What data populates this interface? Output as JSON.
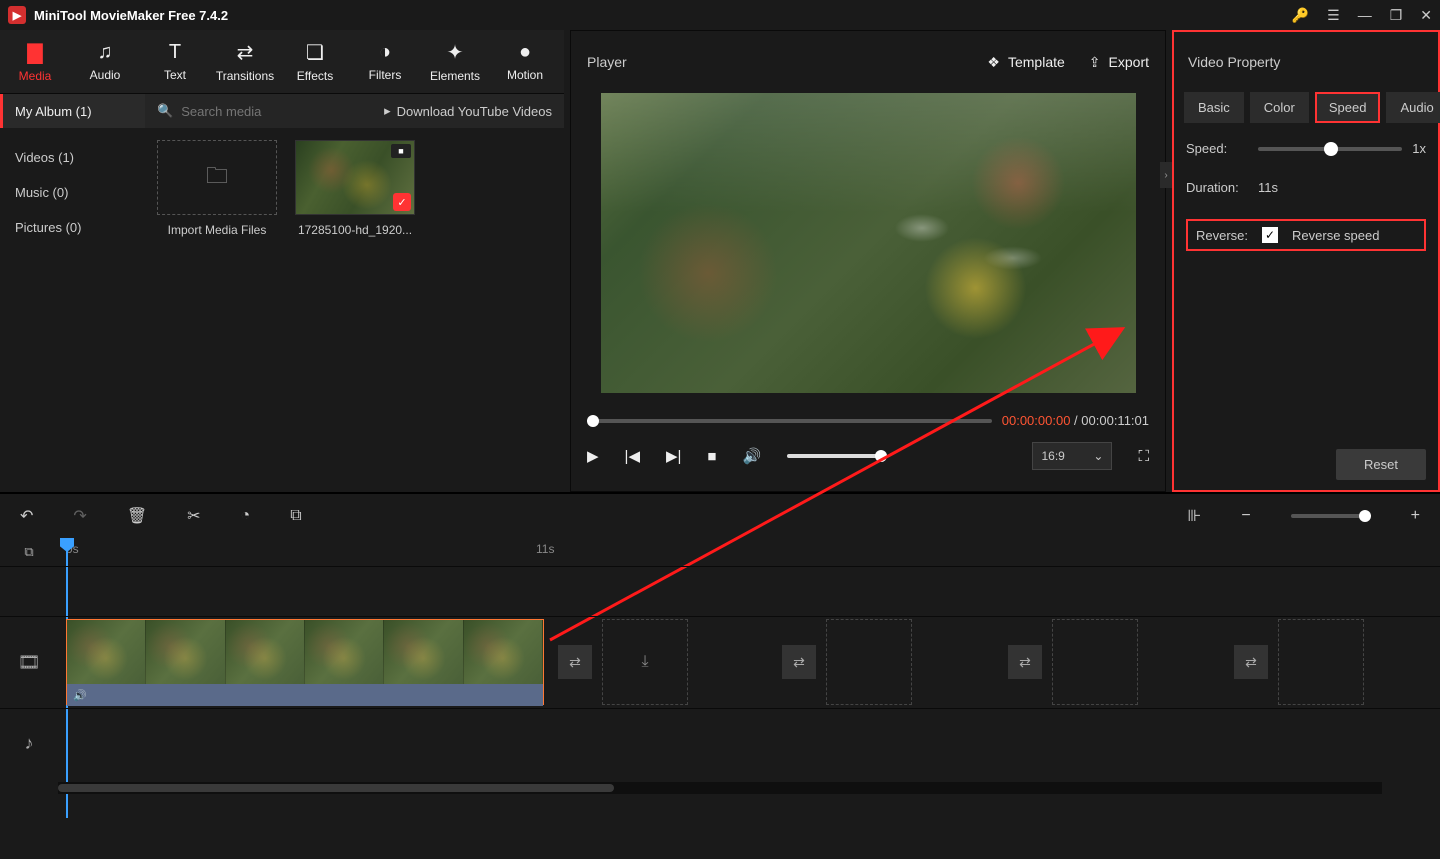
{
  "titlebar": {
    "app_title": "MiniTool MovieMaker Free 7.4.2"
  },
  "toolbar": {
    "items": [
      {
        "label": "Media"
      },
      {
        "label": "Audio"
      },
      {
        "label": "Text"
      },
      {
        "label": "Transitions"
      },
      {
        "label": "Effects"
      },
      {
        "label": "Filters"
      },
      {
        "label": "Elements"
      },
      {
        "label": "Motion"
      }
    ]
  },
  "media": {
    "album_tab": "My Album (1)",
    "search_placeholder": "Search media",
    "youtube_link": "Download YouTube Videos",
    "sidebar": {
      "videos": "Videos (1)",
      "music": "Music (0)",
      "pictures": "Pictures (0)"
    },
    "import_label": "Import Media Files",
    "clip_name": "17285100-hd_1920..."
  },
  "player": {
    "title": "Player",
    "template_btn": "Template",
    "export_btn": "Export",
    "time_current": "00:00:00:00",
    "time_sep": " / ",
    "time_total": "00:00:11:01",
    "ratio": "16:9"
  },
  "props": {
    "header": "Video Property",
    "tabs": {
      "basic": "Basic",
      "color": "Color",
      "speed": "Speed",
      "audio": "Audio"
    },
    "speed_label": "Speed:",
    "speed_value": "1x",
    "duration_label": "Duration:",
    "duration_value": "11s",
    "reverse_label": "Reverse:",
    "reverse_checkbox": "Reverse speed",
    "reset": "Reset"
  },
  "timeline": {
    "marks": {
      "zero": "0s",
      "eleven": "11s"
    }
  }
}
